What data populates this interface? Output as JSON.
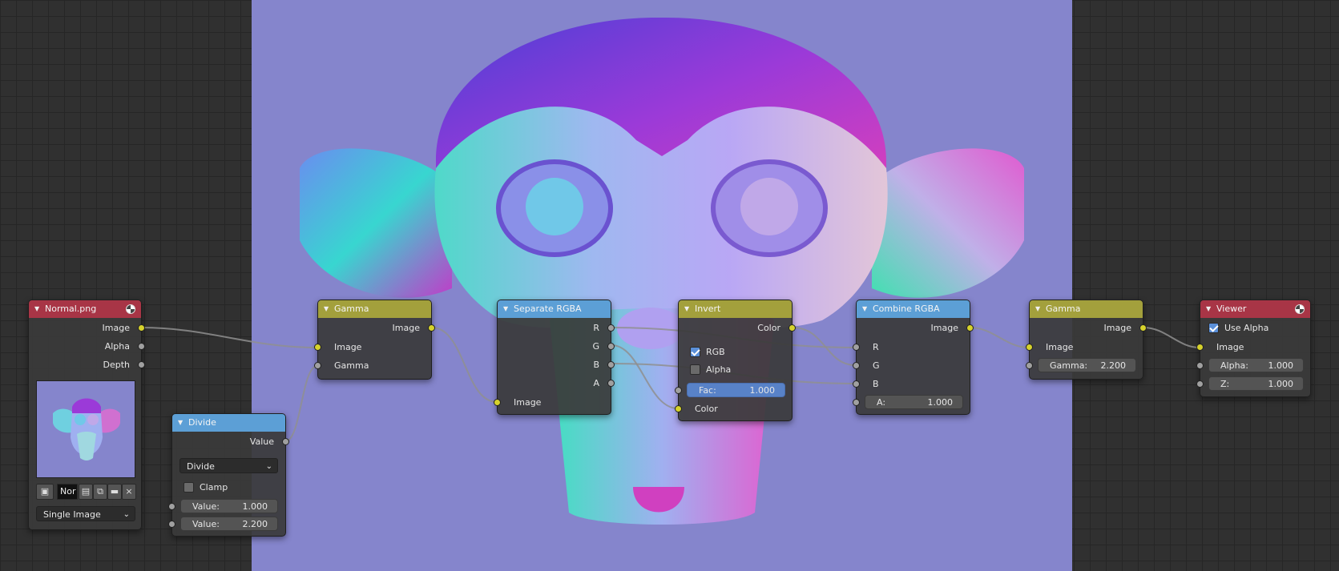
{
  "nodes": {
    "image": {
      "title": "Normal.png",
      "outputs": [
        "Image",
        "Alpha",
        "Depth"
      ],
      "name_field": "Nor",
      "source": "Single Image"
    },
    "divide": {
      "title": "Divide",
      "output": "Value",
      "operation": "Divide",
      "clamp_label": "Clamp",
      "value1_label": "Value:",
      "value1": "1.000",
      "value2_label": "Value:",
      "value2": "2.200"
    },
    "gamma1": {
      "title": "Gamma",
      "output": "Image",
      "inputs": [
        "Image",
        "Gamma"
      ]
    },
    "separate": {
      "title": "Separate RGBA",
      "outputs": [
        "R",
        "G",
        "B",
        "A"
      ],
      "input": "Image"
    },
    "invert": {
      "title": "Invert",
      "output": "Color",
      "rgb_label": "RGB",
      "alpha_label": "Alpha",
      "fac_label": "Fac:",
      "fac_value": "1.000",
      "input": "Color"
    },
    "combine": {
      "title": "Combine RGBA",
      "output": "Image",
      "inputs": [
        "R",
        "G",
        "B"
      ],
      "a_label": "A:",
      "a_value": "1.000"
    },
    "gamma2": {
      "title": "Gamma",
      "output": "Image",
      "input": "Image",
      "gamma_label": "Gamma:",
      "gamma_value": "2.200"
    },
    "viewer": {
      "title": "Viewer",
      "use_alpha_label": "Use Alpha",
      "input": "Image",
      "alpha_label": "Alpha:",
      "alpha_value": "1.000",
      "z_label": "Z:",
      "z_value": "1.000"
    }
  },
  "colors": {
    "header_input": "#a83546",
    "header_color": "#a3a03c",
    "header_converter": "#5c9fd6",
    "socket_color": "#d6d22c",
    "socket_value": "#a0a0a0",
    "backdrop": "#8585cc"
  },
  "icons": {
    "collapse": "▼",
    "image_type": "image-icon",
    "new": "new-file-icon",
    "duplicate": "duplicate-icon",
    "open": "folder-icon",
    "close": "×",
    "dropdown": "⌄"
  }
}
